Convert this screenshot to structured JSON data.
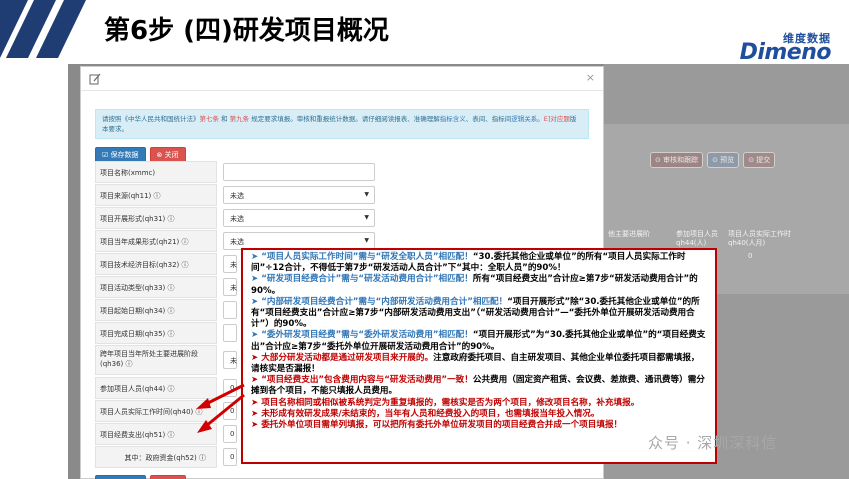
{
  "header": {
    "title": "第6步  (四)研发项目概况",
    "logo_cn": "维度数据",
    "logo_en": "Dimeno"
  },
  "background": {
    "buttons": [
      "⊙ 审核和跟踪",
      "⊙ 预览",
      "⊙ 提交"
    ],
    "headers": [
      "项目当年所处主要进展阶段",
      "参加项目人员(人)\nqh44(人)",
      "项目人员实际工作时间\nqh40(人月)"
    ],
    "headers_short": [
      "他主要进展阶",
      "参加项目人员",
      "项目人员实际工作时"
    ],
    "headers_code": [
      "",
      "qh44(人)",
      "qh40(人月)"
    ],
    "cell_value": "0"
  },
  "modal": {
    "close": "×",
    "notice": {
      "p1": "请按照《中华人民共和国统计法》",
      "r1": "第七条",
      "p2": " 和 ",
      "r2": "第九条",
      "p3": " 规定要求填报。审核和重报统计数据。请仔细阅读报表、准确理解",
      "b1": "指标含义",
      "p4": "、表间、指标间",
      "b2": "逻辑关系",
      "p5": "。",
      "r3": "E]对应题",
      "p6": "版本要求。"
    },
    "save_label": "保存数据",
    "close_label": "关闭",
    "rows": [
      {
        "label": "项目名称(xmmc)",
        "value": "",
        "kind": "input"
      },
      {
        "label": "项目来源(qh11) ⓘ",
        "value": "未选",
        "kind": "select"
      },
      {
        "label": "项目开展形式(qh31) ⓘ",
        "value": "未选",
        "kind": "select"
      },
      {
        "label": "项目当年成果形式(qh21) ⓘ",
        "value": "未选",
        "kind": "select"
      },
      {
        "label": "项目技术经济目标(qh32) ⓘ",
        "value": "未",
        "kind": "short"
      },
      {
        "label": "项目活动类型(qh33) ⓘ",
        "value": "未",
        "kind": "short"
      },
      {
        "label": "项目起始日期(qh34) ⓘ",
        "value": "",
        "kind": "short"
      },
      {
        "label": "项目完成日期(qh35) ⓘ",
        "value": "",
        "kind": "short"
      },
      {
        "label": "跨年项目当年所处主要进展阶段(qh36) ⓘ",
        "value": "未",
        "kind": "short-tall"
      },
      {
        "label": "参加项目人员(qh44) ⓘ",
        "value": "0",
        "kind": "short"
      },
      {
        "label": "项目人员实际工作时间(qh40) ⓘ",
        "value": "0",
        "kind": "short"
      },
      {
        "label": "项目经费支出(qh51) ⓘ",
        "value": "0",
        "kind": "short"
      },
      {
        "label": "其中：政府资金(qh52) ⓘ",
        "value": "0",
        "kind": "short-indent"
      }
    ]
  },
  "annotation": [
    {
      "mark": "➤",
      "segs": [
        {
          "c": "bl",
          "t": "“项目人员实际工作时间”需与“研发全职人员”相匹配！"
        },
        {
          "c": "blk",
          "t": "“30.委托其他企业或单位”的所有“项目人员实际工作时间”÷12合计，不得低于第7步“研发活动人员合计”下“其中：全职人员”的90%！"
        }
      ]
    },
    {
      "mark": "➤",
      "segs": [
        {
          "c": "bl",
          "t": "“研发项目经费合计”需与“研发活动费用合计”相匹配！"
        },
        {
          "c": "blk",
          "t": "所有“项目经费支出”合计应≥第7步“研发活动费用合计”的90%。"
        }
      ]
    },
    {
      "mark": "➤",
      "segs": [
        {
          "c": "bl",
          "t": "“内部研发项目经费合计”需与“内部研发活动费用合计”相匹配！"
        },
        {
          "c": "blk",
          "t": "“项目开展形式”除“30.委托其他企业或单位”的所有“项目经费支出”合计应≥第7步“内部研发活动费用支出”（“研发活动费用合计”—“委托外单位开展研发活动费用合计”）的90%。"
        }
      ]
    },
    {
      "mark": "➤",
      "segs": [
        {
          "c": "bl",
          "t": "“委外研发项目经费”需与“委外研发活动费用”相匹配！"
        },
        {
          "c": "blk",
          "t": "“项目开展形式”为“30.委托其他企业或单位”的“项目经费支出”合计应≥第7步“委托外单位开展研发活动费用合计”的90%。"
        }
      ]
    },
    {
      "mark": "➤",
      "rmark": true,
      "segs": [
        {
          "c": "rd",
          "t": "大部分研发活动都是通过研发项目来开展的。"
        },
        {
          "c": "blk",
          "t": "注意政府委托项目、自主研发项目、其他企业单位委托项目都需填报，请核实是否漏报！"
        }
      ]
    },
    {
      "mark": "➤",
      "rmark": true,
      "segs": [
        {
          "c": "rd",
          "t": "“项目经费支出”包含费用内容与“研发活动费用”一致！"
        },
        {
          "c": "blk",
          "t": "公共费用（固定资产租赁、会议费、差旅费、通讯费等）需分摊到各个项目，不能只填报人员费用。"
        }
      ]
    },
    {
      "mark": "➤",
      "rmark": true,
      "segs": [
        {
          "c": "rd",
          "t": "项目名称相同或相似被系统判定为重复填报的，需核实是否为两个项目，修改项目名称，补充填报。"
        }
      ]
    },
    {
      "mark": "➤",
      "rmark": true,
      "segs": [
        {
          "c": "rd",
          "t": "未形成有效研发成果/未结束的，当年有人员和经费投入的项目，也需填报当年投入情况。"
        }
      ]
    },
    {
      "mark": "➤",
      "rmark": true,
      "segs": [
        {
          "c": "rd",
          "t": "委托外单位项目需单列填报，可以把所有委托外单位研发项目的项目经费合并成一个项目填报！"
        }
      ]
    }
  ],
  "watermark": "众号 · 深圳深科信",
  "colors": {
    "accent_blue": "#1f4e9c",
    "anno_red": "#c00000",
    "anno_blue": "#2e75b6"
  }
}
